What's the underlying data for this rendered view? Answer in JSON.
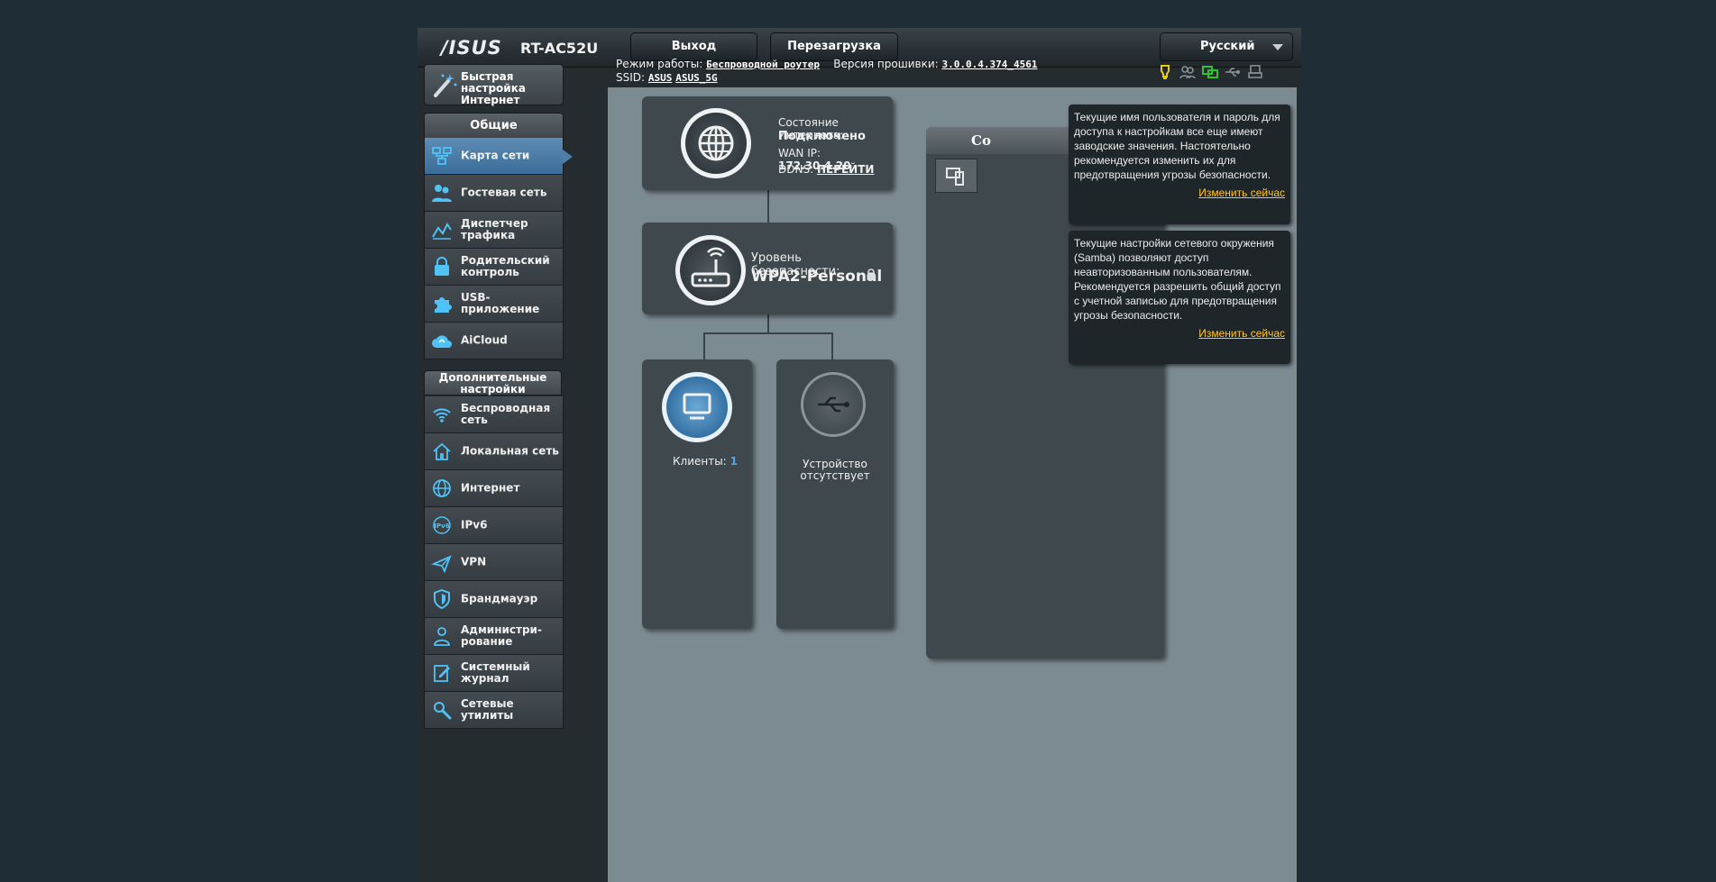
{
  "header": {
    "logo": "/ISUS",
    "model": "RT-AC52U",
    "logout_label": "Выход",
    "reboot_label": "Перезагрузка",
    "language": "Русский"
  },
  "info": {
    "mode_label": "Режим работы:",
    "mode_value": "Беспроводной роутер",
    "firmware_label": "Версия прошивки:",
    "firmware_value": "3.0.0.4.374_4561",
    "ssid_label": "SSID:",
    "ssid_values": [
      "ASUS",
      "ASUS_5G"
    ]
  },
  "sidebar": {
    "quick_setup": "Быстрая настройка Интернет",
    "general_title": "Общие",
    "general_items": [
      {
        "label": "Карта сети",
        "icon": "network-map-icon",
        "active": true
      },
      {
        "label": "Гостевая сеть",
        "icon": "guest-network-icon"
      },
      {
        "label": "Диспетчер трафика",
        "icon": "traffic-icon"
      },
      {
        "label": "Родительский контроль",
        "icon": "parental-lock-icon"
      },
      {
        "label": "USB-приложение",
        "icon": "puzzle-icon"
      },
      {
        "label": "AiCloud",
        "icon": "cloud-icon"
      }
    ],
    "advanced_title": "Дополнительные настройки",
    "advanced_items": [
      {
        "label": "Беспроводная сеть",
        "icon": "wifi-icon"
      },
      {
        "label": "Локальная сеть",
        "icon": "home-icon"
      },
      {
        "label": "Интернет",
        "icon": "globe-icon"
      },
      {
        "label": "IPv6",
        "icon": "ipv6-icon"
      },
      {
        "label": "VPN",
        "icon": "vpn-icon"
      },
      {
        "label": "Брандмауэр",
        "icon": "shield-icon"
      },
      {
        "label": "Администри-рование",
        "icon": "admin-icon"
      },
      {
        "label": "Системный журнал",
        "icon": "log-icon"
      },
      {
        "label": "Сетевые утилиты",
        "icon": "tools-icon"
      }
    ]
  },
  "map": {
    "internet_status_label": "Состояние Интернета:",
    "internet_status_value": "Подключено",
    "wan_label": "WAN IP:",
    "wan_ip": "172.30.4.20",
    "ddns_label": "DDNS:",
    "ddns_link": "ПЕРЕЙТИ",
    "security_label": "Уровень безопасности:",
    "security_value": "WPA2-Personal",
    "clients_label": "Клиенты:",
    "clients_count": "1",
    "usb_status": "Устройство отсутствует",
    "panel_title": "Со"
  },
  "notifications": [
    {
      "text": "Текущие имя пользователя и пароль для доступа к настройкам все еще имеют заводские значения. Настоятельно рекомендуется изменить их для предотвращения угрозы безопасности.",
      "action": "Изменить сейчас"
    },
    {
      "text": "Текущие настройки сетевого окружения (Samba) позволяют доступ неавторизованным пользователям. Рекомендуется разрешить общий доступ с учетной записью для предотвращения угрозы безопасности.",
      "action": "Изменить сейчас"
    }
  ],
  "colors": {
    "accent": "#4c7ea8",
    "warning_link": "#ffc728",
    "map_bg": "#7c8a92"
  }
}
